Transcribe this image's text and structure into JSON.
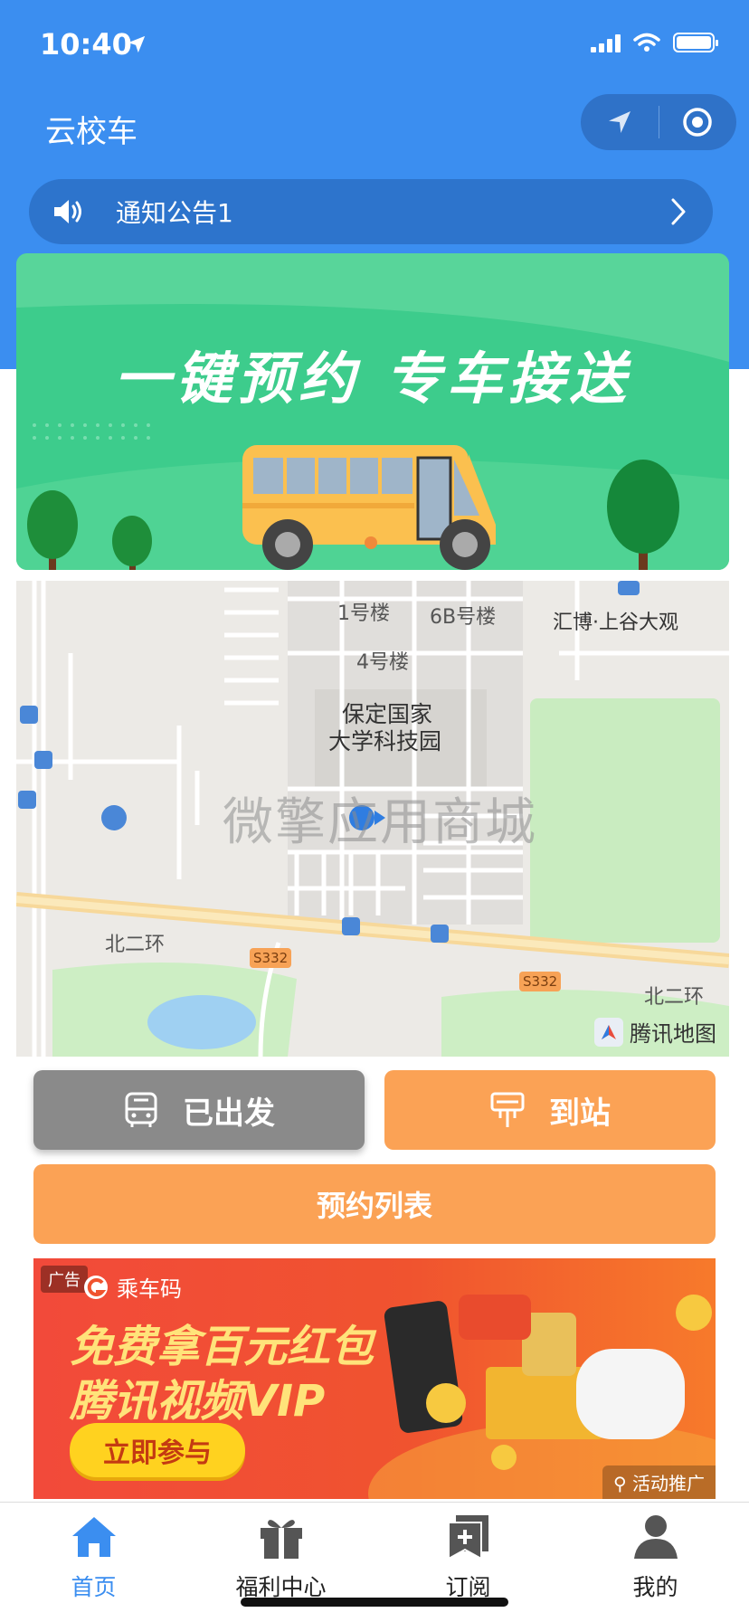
{
  "status_bar": {
    "time": "10:40"
  },
  "nav": {
    "title": "云校车"
  },
  "notice": {
    "text": "通知公告1"
  },
  "banner": {
    "title": "一键预约 专车接送"
  },
  "map": {
    "labels": {
      "building1": "1号楼",
      "building6b": "6B号楼",
      "building4": "4号楼",
      "park_line1": "保定国家",
      "park_line2": "大学科技园",
      "poi_huibo": "汇博·上谷大观",
      "road_left": "北二环",
      "road_right": "北二环",
      "highway1": "S332",
      "highway2": "S332"
    },
    "watermark": "微擎应用商城",
    "logo_text": "腾讯地图"
  },
  "actions": {
    "depart_label": "已出发",
    "arrive_label": "到站",
    "list_label": "预约列表"
  },
  "ad": {
    "tag": "广告",
    "brand": "乘车码",
    "line1": "免费拿百元红包",
    "line2": "腾讯视频VIP",
    "cta": "立即参与",
    "promo": "活动推广"
  },
  "tabbar": {
    "items": [
      {
        "label": "首页",
        "active": true
      },
      {
        "label": "福利中心"
      },
      {
        "label": "订阅"
      },
      {
        "label": "我的"
      }
    ]
  },
  "colors": {
    "primary_blue": "#3b8ef0",
    "orange": "#fba255",
    "gray_button": "#8a8a8a",
    "banner_green": "#3dcc8c"
  }
}
